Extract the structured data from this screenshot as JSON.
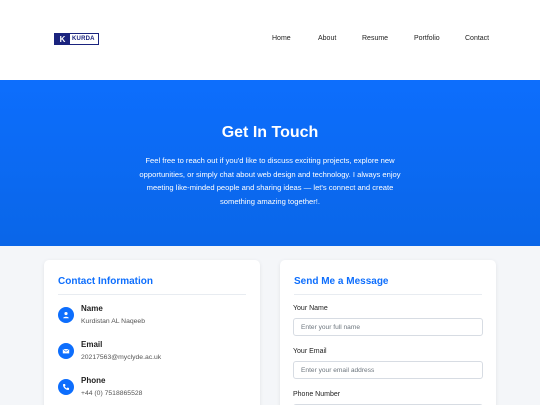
{
  "header": {
    "logo_letter": "K",
    "logo_text": "KURDA",
    "nav": [
      "Home",
      "About",
      "Resume",
      "Portfolio",
      "Contact"
    ]
  },
  "hero": {
    "title": "Get In Touch",
    "text": "Feel free to reach out if you'd like to discuss exciting projects, explore new opportunities, or simply chat about web design and technology. I always enjoy meeting like-minded people and sharing ideas — let's connect and create something amazing together!."
  },
  "contact_info": {
    "title": "Contact Information",
    "items": [
      {
        "label": "Name",
        "value": "Kurdistan AL Naqeeb",
        "icon": "user-icon"
      },
      {
        "label": "Email",
        "value": "20217563@myclyde.ac.uk",
        "icon": "envelope-icon"
      },
      {
        "label": "Phone",
        "value": "+44 (0) 7518865528",
        "icon": "phone-icon"
      }
    ]
  },
  "message_form": {
    "title": "Send Me a Message",
    "fields": [
      {
        "label": "Your Name",
        "placeholder": "Enter your full name",
        "value": ""
      },
      {
        "label": "Your Email",
        "placeholder": "Enter your email address",
        "value": ""
      },
      {
        "label": "Phone Number",
        "placeholder": "",
        "value": ""
      }
    ]
  },
  "colors": {
    "accent": "#0d6efd",
    "logo": "#1a237e",
    "background": "#f4f6f9"
  }
}
